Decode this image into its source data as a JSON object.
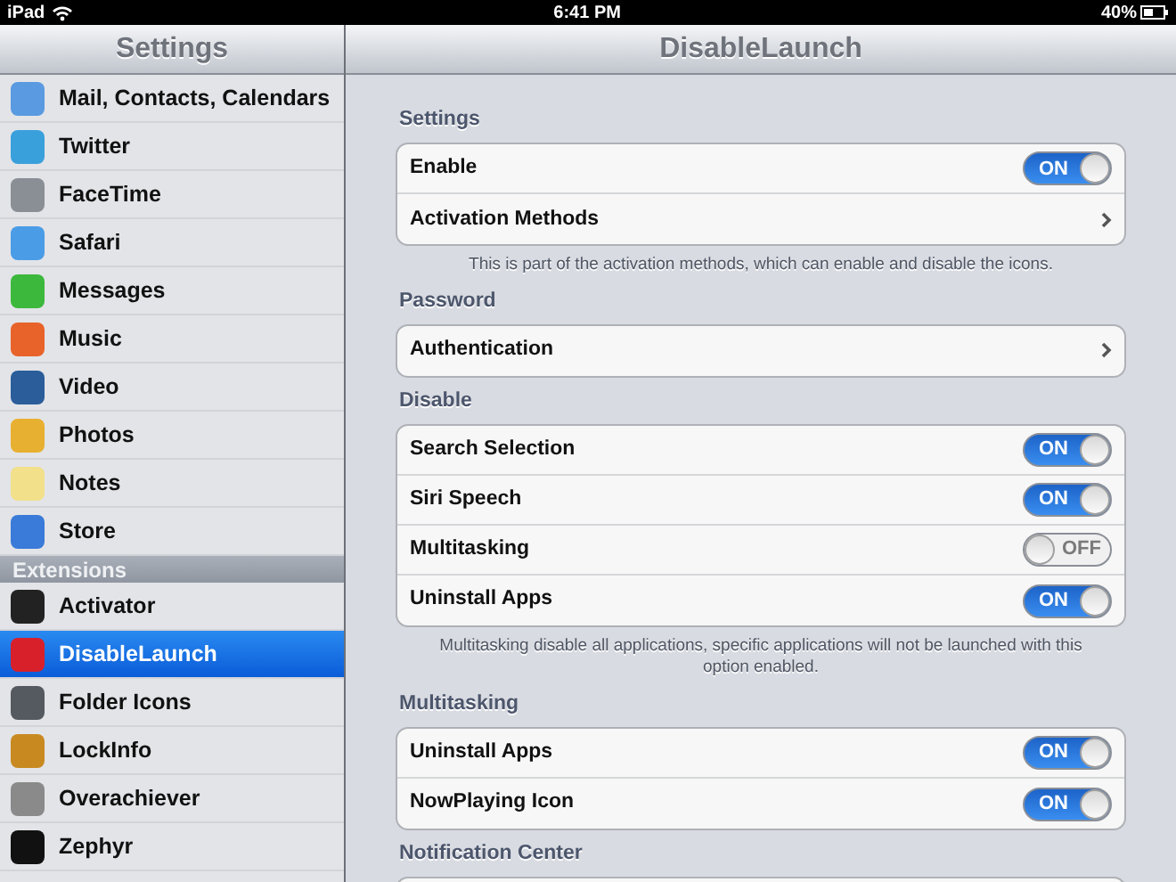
{
  "status_bar": {
    "device": "iPad",
    "time": "6:41 PM",
    "battery": "40%"
  },
  "sidebar": {
    "title": "Settings",
    "sections": [
      {
        "items": [
          {
            "label": "Mail, Contacts, Calendars",
            "color": "#5a9ae0",
            "selected": false
          },
          {
            "label": "Twitter",
            "color": "#3aa0dc",
            "selected": false
          },
          {
            "label": "FaceTime",
            "color": "#8a8f95",
            "selected": false
          },
          {
            "label": "Safari",
            "color": "#4a9ce6",
            "selected": false
          },
          {
            "label": "Messages",
            "color": "#3cb83c",
            "selected": false
          },
          {
            "label": "Music",
            "color": "#e8632a",
            "selected": false
          },
          {
            "label": "Video",
            "color": "#2a5d9a",
            "selected": false
          },
          {
            "label": "Photos",
            "color": "#e8b030",
            "selected": false
          },
          {
            "label": "Notes",
            "color": "#f2e08a",
            "selected": false
          },
          {
            "label": "Store",
            "color": "#3a7ad8",
            "selected": false
          }
        ]
      },
      {
        "header": "Extensions",
        "items": [
          {
            "label": "Activator",
            "color": "#222222",
            "selected": false
          },
          {
            "label": "DisableLaunch",
            "color": "#d8202a",
            "selected": true
          },
          {
            "label": "Folder Icons",
            "color": "#555a60",
            "selected": false
          },
          {
            "label": "LockInfo",
            "color": "#c88a20",
            "selected": false
          },
          {
            "label": "Overachiever",
            "color": "#8a8a8a",
            "selected": false
          },
          {
            "label": "Zephyr",
            "color": "#111111",
            "selected": false
          }
        ]
      }
    ]
  },
  "detail": {
    "title": "DisableLaunch",
    "groups": [
      {
        "header": "Settings",
        "rows": [
          {
            "label": "Enable",
            "kind": "switch",
            "on": true,
            "value": "ON"
          },
          {
            "label": "Activation Methods",
            "kind": "link"
          }
        ],
        "footer": "This is part of the activation methods, which can enable and disable the icons."
      },
      {
        "header": "Password",
        "rows": [
          {
            "label": "Authentication",
            "kind": "link"
          }
        ]
      },
      {
        "header": "Disable",
        "rows": [
          {
            "label": "Search Selection",
            "kind": "switch",
            "on": true,
            "value": "ON"
          },
          {
            "label": "Siri Speech",
            "kind": "switch",
            "on": true,
            "value": "ON"
          },
          {
            "label": "Multitasking",
            "kind": "switch",
            "on": false,
            "value": "OFF"
          },
          {
            "label": "Uninstall Apps",
            "kind": "switch",
            "on": true,
            "value": "ON"
          }
        ],
        "footer": "Multitasking disable all applications, specific applications will not be launched with this option enabled."
      },
      {
        "header": "Multitasking",
        "rows": [
          {
            "label": "Uninstall Apps",
            "kind": "switch",
            "on": true,
            "value": "ON"
          },
          {
            "label": "NowPlaying Icon",
            "kind": "switch",
            "on": true,
            "value": "ON"
          }
        ]
      },
      {
        "header": "Notification Center"
      }
    ]
  }
}
